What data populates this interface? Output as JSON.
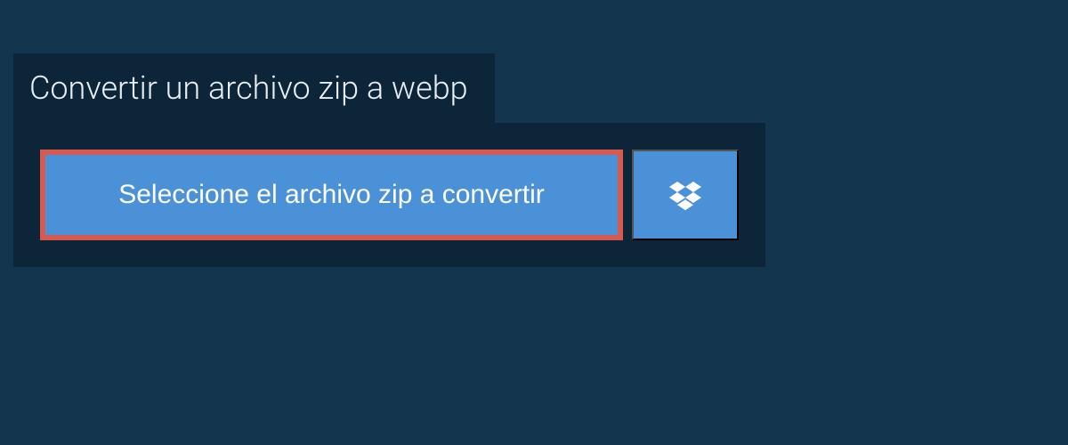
{
  "header": {
    "title": "Convertir un archivo zip a webp"
  },
  "buttons": {
    "select_label": "Seleccione el archivo zip a convertir"
  },
  "colors": {
    "background": "#14354e",
    "panel": "#0d2539",
    "button": "#4a91d8",
    "highlight_border": "#d65a4f"
  }
}
